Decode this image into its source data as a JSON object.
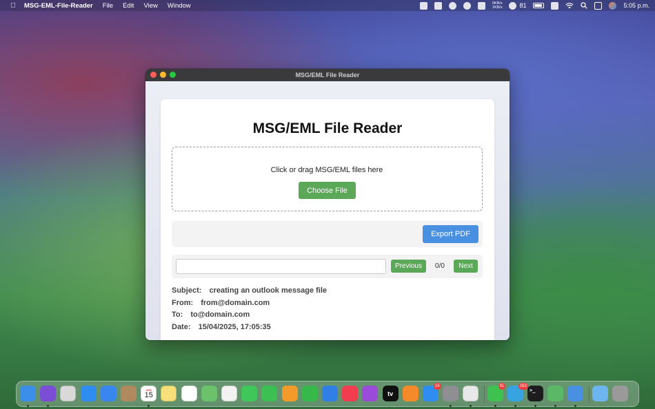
{
  "menubar": {
    "app_name": "MSG-EML-File-Reader",
    "menus": [
      "File",
      "Edit",
      "View",
      "Window"
    ],
    "net_up": "0KB/s",
    "net_down": "1KB/s",
    "wechat_count": "81",
    "clock": "5:05 p.m."
  },
  "window": {
    "title": "MSG/EML File Reader"
  },
  "app": {
    "heading": "MSG/EML File Reader",
    "dropzone_text": "Click or drag MSG/EML files here",
    "choose_file_label": "Choose File",
    "export_pdf_label": "Export PDF",
    "search_placeholder": "",
    "previous_label": "Previous",
    "counter": "0/0",
    "next_label": "Next",
    "email": {
      "subject_label": "Subject:",
      "subject": "creating an outlook message file",
      "from_label": "From:",
      "from": "from@domain.com",
      "to_label": "To:",
      "to": "to@domain.com",
      "date_label": "Date:",
      "date": "15/04/2025, 17:05:35"
    }
  },
  "dock": {
    "calendar_month": "APR",
    "calendar_day": "15",
    "appstore_badge": "16",
    "wechat_badge": "81",
    "telegram_badge": "283",
    "appletv_label": "tv",
    "icons": [
      {
        "name": "finder-icon",
        "color": "#3b8fe8"
      },
      {
        "name": "siri-icon",
        "color": "#7a4fd6"
      },
      {
        "name": "launchpad-icon",
        "color": "#d9d9d9"
      },
      {
        "name": "safari-icon",
        "color": "#2f8cf0"
      },
      {
        "name": "mail-icon",
        "color": "#3a86f0"
      },
      {
        "name": "contacts-icon",
        "color": "#b08a5e"
      },
      {
        "name": "calendar-icon",
        "color": "#ffffff"
      },
      {
        "name": "notes-icon",
        "color": "#f7e07a"
      },
      {
        "name": "reminders-icon",
        "color": "#ffffff"
      },
      {
        "name": "maps-icon",
        "color": "#6cc26b"
      },
      {
        "name": "photos-icon",
        "color": "#f3f3f3"
      },
      {
        "name": "messages-icon",
        "color": "#40c75a"
      },
      {
        "name": "facetime-icon",
        "color": "#3cc052"
      },
      {
        "name": "pages-icon",
        "color": "#f39a2b"
      },
      {
        "name": "numbers-icon",
        "color": "#36b94a"
      },
      {
        "name": "keynote-icon",
        "color": "#2f7fe6"
      },
      {
        "name": "music-icon",
        "color": "#f23c50"
      },
      {
        "name": "podcasts-icon",
        "color": "#9b4bd9"
      },
      {
        "name": "appletv-icon",
        "color": "#111111"
      },
      {
        "name": "books-icon",
        "color": "#f48a2a"
      },
      {
        "name": "appstore-icon",
        "color": "#2f8cf0"
      },
      {
        "name": "system-settings-icon",
        "color": "#8e8e93"
      },
      {
        "name": "chrome-icon",
        "color": "#e8e8e8"
      },
      {
        "name": "wechat-icon",
        "color": "#3ec24f"
      },
      {
        "name": "telegram-icon",
        "color": "#37a3e0"
      },
      {
        "name": "terminal-icon",
        "color": "#1d1d1f"
      },
      {
        "name": "electron-app-icon",
        "color": "#5bb867"
      },
      {
        "name": "msg-reader-icon",
        "color": "#4a90e2"
      },
      {
        "name": "folder-icon",
        "color": "#6cb5ee"
      },
      {
        "name": "trash-icon",
        "color": "#9a9a9a"
      }
    ]
  }
}
